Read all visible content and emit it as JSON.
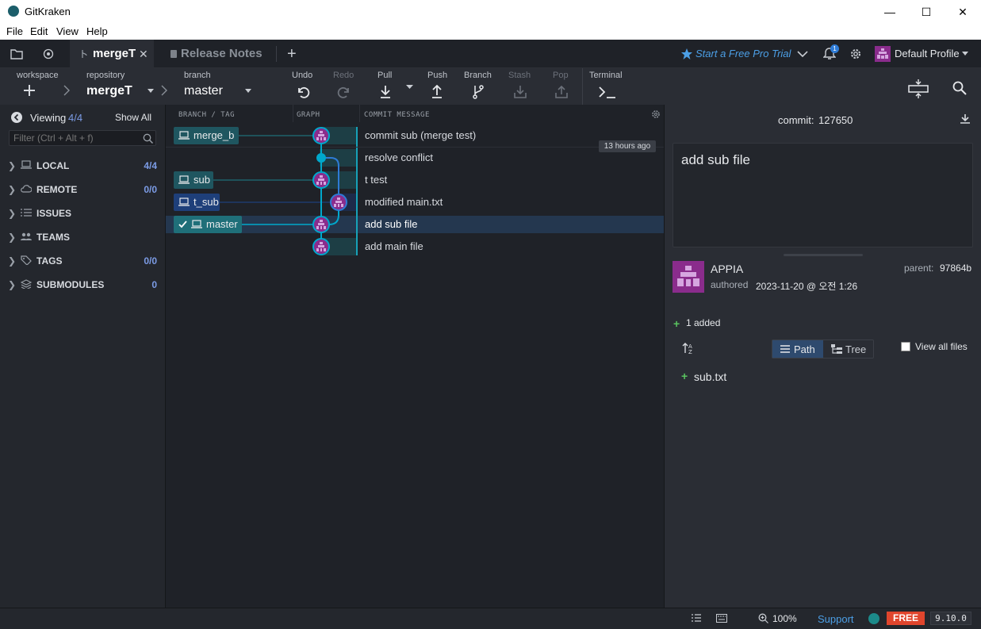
{
  "window": {
    "title": "GitKraken",
    "minimize": "—",
    "maximize": "☐",
    "close": "✕"
  },
  "menu": {
    "file": "File",
    "edit": "Edit",
    "view": "View",
    "help": "Help"
  },
  "tabs": {
    "active": "mergeT",
    "release": "Release Notes",
    "new_tab": "+",
    "close": "✕"
  },
  "topright": {
    "trial": "Start a Free Pro Trial",
    "notif_count": "1",
    "profile": "Default Profile"
  },
  "toolbar": {
    "workspace_label": "workspace",
    "repository_label": "repository",
    "repository": "mergeT",
    "branch_label": "branch",
    "branch": "master",
    "undo": "Undo",
    "redo": "Redo",
    "pull": "Pull",
    "push": "Push",
    "branch_btn": "Branch",
    "stash": "Stash",
    "pop": "Pop",
    "terminal": "Terminal"
  },
  "sidebar": {
    "viewing_label": "Viewing",
    "viewing_count": "4/4",
    "show_all": "Show All",
    "filter_placeholder": "Filter (Ctrl + Alt + f)",
    "sections": [
      {
        "label": "LOCAL",
        "count": "4/4",
        "icon": "laptop-icon"
      },
      {
        "label": "REMOTE",
        "count": "0/0",
        "icon": "cloud-icon"
      },
      {
        "label": "ISSUES",
        "count": "",
        "icon": "list-icon"
      },
      {
        "label": "TEAMS",
        "count": "",
        "icon": "users-icon"
      },
      {
        "label": "TAGS",
        "count": "0/0",
        "icon": "tag-icon"
      },
      {
        "label": "SUBMODULES",
        "count": "0",
        "icon": "layers-icon"
      }
    ]
  },
  "graph": {
    "headers": {
      "branch_tag": "BRANCH / TAG",
      "graph": "GRAPH",
      "message": "COMMIT MESSAGE"
    },
    "timestamp": "13 hours ago",
    "commits": [
      {
        "message": "commit sub (merge test)",
        "branch": "merge_b"
      },
      {
        "message": "resolve conflict",
        "branch": ""
      },
      {
        "message": "t test",
        "branch": "sub"
      },
      {
        "message": "modified main.txt",
        "branch": "t_sub"
      },
      {
        "message": "add sub file",
        "branch": "master"
      },
      {
        "message": "add main file",
        "branch": ""
      }
    ]
  },
  "detail": {
    "commit_label": "commit:",
    "commit_sha": "127650",
    "message": "add sub file",
    "author": "APPIA",
    "authored_label": "authored",
    "authored_date": "2023-11-20 @ 오전 1:26",
    "parent_label": "parent:",
    "parent_sha": "97864b",
    "added_summary": "1 added",
    "path_btn": "Path",
    "tree_btn": "Tree",
    "view_all": "View all files",
    "files": [
      {
        "name": "sub.txt",
        "status": "+"
      }
    ]
  },
  "status": {
    "zoom": "100%",
    "support": "Support",
    "plan": "FREE",
    "version": "9.10.0"
  },
  "colors": {
    "accent": "#4c9fe6",
    "branch_teal": "#1f6f79",
    "graph_line": "#00a8cc",
    "graph_line2": "#2e6bd6",
    "avatar": "#8a2c8c",
    "added": "#59c35f",
    "free_badge": "#e0452d"
  }
}
